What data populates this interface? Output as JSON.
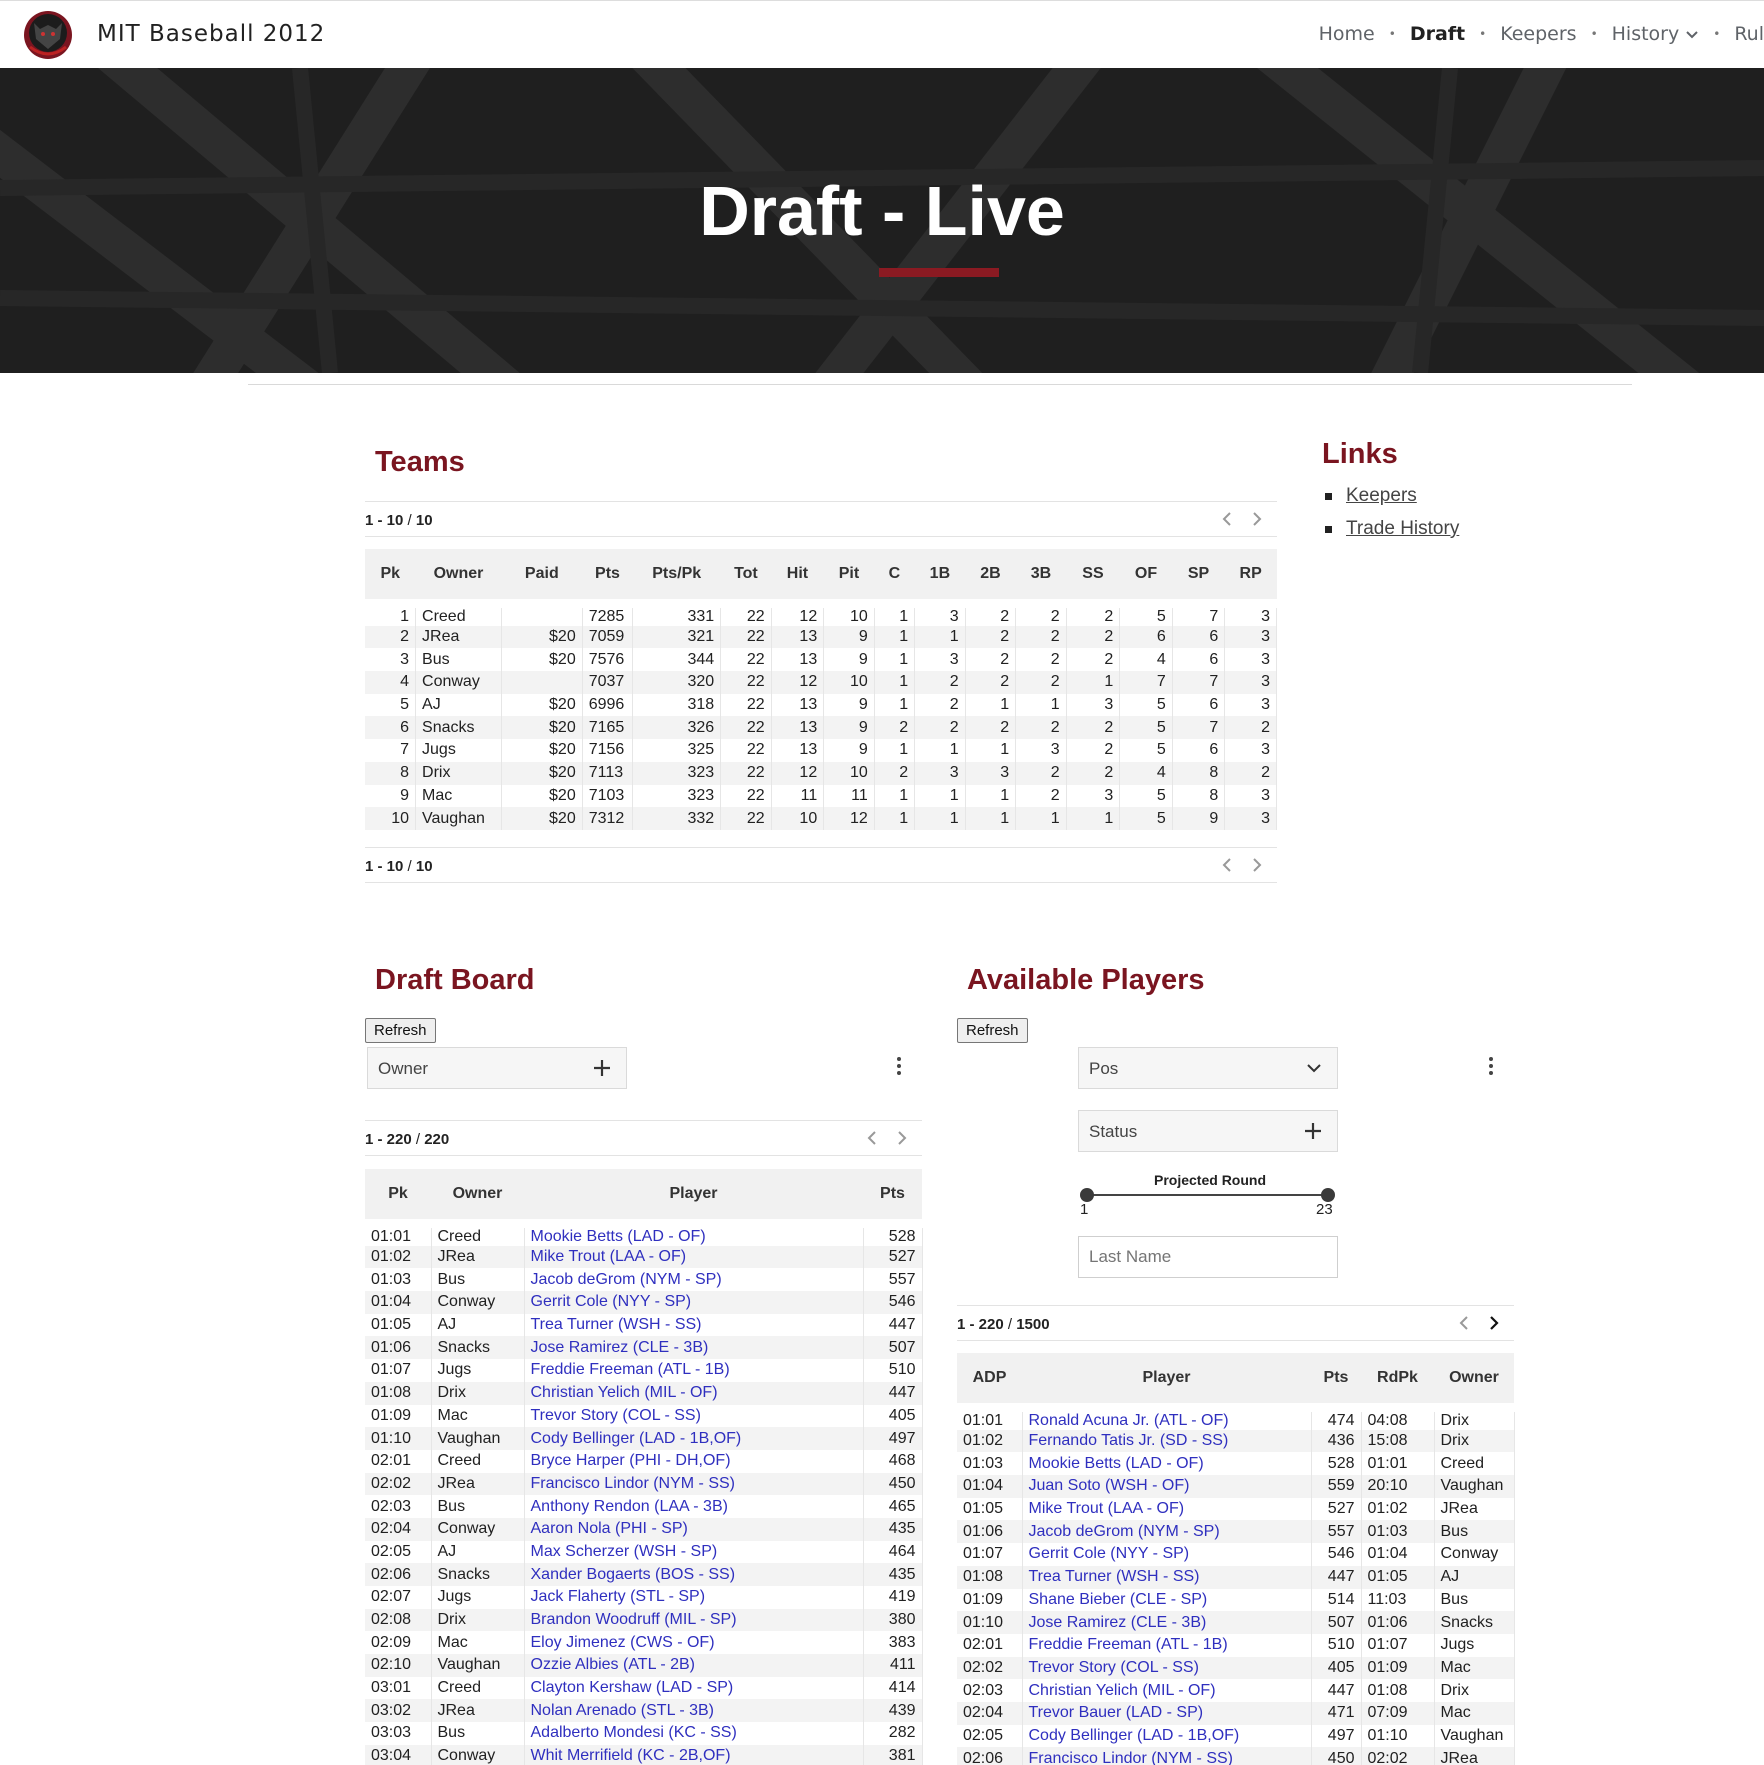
{
  "site": {
    "title": "MIT Baseball 2012"
  },
  "nav": {
    "items": [
      "Home",
      "Draft",
      "Keepers",
      "History",
      "Rul"
    ],
    "active": "Draft"
  },
  "hero": {
    "title": "Draft - Live"
  },
  "teams": {
    "title": "Teams",
    "pager": {
      "range": "1 - 10",
      "total": "10"
    },
    "columns": [
      "Pk",
      "Owner",
      "Paid",
      "Pts",
      "Pts/Pk",
      "Tot",
      "Hit",
      "Pit",
      "C",
      "1B",
      "2B",
      "3B",
      "SS",
      "OF",
      "SP",
      "RP"
    ],
    "rows": [
      [
        "1",
        "Creed",
        "",
        "7285",
        "331",
        "22",
        "12",
        "10",
        "1",
        "3",
        "2",
        "2",
        "2",
        "5",
        "7",
        "3"
      ],
      [
        "2",
        "JRea",
        "$20",
        "7059",
        "321",
        "22",
        "13",
        "9",
        "1",
        "1",
        "2",
        "2",
        "2",
        "6",
        "6",
        "3"
      ],
      [
        "3",
        "Bus",
        "$20",
        "7576",
        "344",
        "22",
        "13",
        "9",
        "1",
        "3",
        "2",
        "2",
        "2",
        "4",
        "6",
        "3"
      ],
      [
        "4",
        "Conway",
        "",
        "7037",
        "320",
        "22",
        "12",
        "10",
        "1",
        "2",
        "2",
        "2",
        "1",
        "7",
        "7",
        "3"
      ],
      [
        "5",
        "AJ",
        "$20",
        "6996",
        "318",
        "22",
        "13",
        "9",
        "1",
        "2",
        "1",
        "1",
        "3",
        "5",
        "6",
        "3"
      ],
      [
        "6",
        "Snacks",
        "$20",
        "7165",
        "326",
        "22",
        "13",
        "9",
        "2",
        "2",
        "2",
        "2",
        "2",
        "5",
        "7",
        "2"
      ],
      [
        "7",
        "Jugs",
        "$20",
        "7156",
        "325",
        "22",
        "13",
        "9",
        "1",
        "1",
        "1",
        "3",
        "2",
        "5",
        "6",
        "3"
      ],
      [
        "8",
        "Drix",
        "$20",
        "7113",
        "323",
        "22",
        "12",
        "10",
        "2",
        "3",
        "3",
        "2",
        "2",
        "4",
        "8",
        "2"
      ],
      [
        "9",
        "Mac",
        "$20",
        "7103",
        "323",
        "22",
        "11",
        "11",
        "1",
        "1",
        "1",
        "2",
        "3",
        "5",
        "8",
        "3"
      ],
      [
        "10",
        "Vaughan",
        "$20",
        "7312",
        "332",
        "22",
        "10",
        "12",
        "1",
        "1",
        "1",
        "1",
        "1",
        "5",
        "9",
        "3"
      ]
    ]
  },
  "links": {
    "title": "Links",
    "items": [
      "Keepers",
      "Trade History"
    ]
  },
  "draft_board": {
    "title": "Draft Board",
    "refresh_label": "Refresh",
    "owner_filter_label": "Owner",
    "pager": {
      "range": "1 - 220",
      "total": "220"
    },
    "columns": [
      "Pk",
      "Owner",
      "Player",
      "Pts"
    ],
    "rows": [
      [
        "01:01",
        "Creed",
        "Mookie Betts (LAD - OF)",
        "528"
      ],
      [
        "01:02",
        "JRea",
        "Mike Trout (LAA - OF)",
        "527"
      ],
      [
        "01:03",
        "Bus",
        "Jacob deGrom (NYM - SP)",
        "557"
      ],
      [
        "01:04",
        "Conway",
        "Gerrit Cole (NYY - SP)",
        "546"
      ],
      [
        "01:05",
        "AJ",
        "Trea Turner (WSH - SS)",
        "447"
      ],
      [
        "01:06",
        "Snacks",
        "Jose Ramirez (CLE - 3B)",
        "507"
      ],
      [
        "01:07",
        "Jugs",
        "Freddie Freeman (ATL - 1B)",
        "510"
      ],
      [
        "01:08",
        "Drix",
        "Christian Yelich (MIL - OF)",
        "447"
      ],
      [
        "01:09",
        "Mac",
        "Trevor Story (COL - SS)",
        "405"
      ],
      [
        "01:10",
        "Vaughan",
        "Cody Bellinger (LAD - 1B,OF)",
        "497"
      ],
      [
        "02:01",
        "Creed",
        "Bryce Harper (PHI - DH,OF)",
        "468"
      ],
      [
        "02:02",
        "JRea",
        "Francisco Lindor (NYM - SS)",
        "450"
      ],
      [
        "02:03",
        "Bus",
        "Anthony Rendon (LAA - 3B)",
        "465"
      ],
      [
        "02:04",
        "Conway",
        "Aaron Nola (PHI - SP)",
        "435"
      ],
      [
        "02:05",
        "AJ",
        "Max Scherzer (WSH - SP)",
        "464"
      ],
      [
        "02:06",
        "Snacks",
        "Xander Bogaerts (BOS - SS)",
        "435"
      ],
      [
        "02:07",
        "Jugs",
        "Jack Flaherty (STL - SP)",
        "419"
      ],
      [
        "02:08",
        "Drix",
        "Brandon Woodruff (MIL - SP)",
        "380"
      ],
      [
        "02:09",
        "Mac",
        "Eloy Jimenez (CWS - OF)",
        "383"
      ],
      [
        "02:10",
        "Vaughan",
        "Ozzie Albies (ATL - 2B)",
        "411"
      ],
      [
        "03:01",
        "Creed",
        "Clayton Kershaw (LAD - SP)",
        "414"
      ],
      [
        "03:02",
        "JRea",
        "Nolan Arenado (STL - 3B)",
        "439"
      ],
      [
        "03:03",
        "Bus",
        "Adalberto Mondesi (KC - SS)",
        "282"
      ],
      [
        "03:04",
        "Conway",
        "Whit Merrifield (KC - 2B,OF)",
        "381"
      ]
    ]
  },
  "available_players": {
    "title": "Available Players",
    "refresh_label": "Refresh",
    "pos_label": "Pos",
    "status_label": "Status",
    "slider": {
      "label": "Projected Round",
      "min": "1",
      "max": "23"
    },
    "last_name_placeholder": "Last Name",
    "pager": {
      "range": "1 - 220",
      "total": "1500"
    },
    "columns": [
      "ADP",
      "Player",
      "Pts",
      "RdPk",
      "Owner"
    ],
    "rows": [
      [
        "01:01",
        "Ronald Acuna Jr. (ATL - OF)",
        "474",
        "04:08",
        "Drix"
      ],
      [
        "01:02",
        "Fernando Tatis Jr. (SD - SS)",
        "436",
        "15:08",
        "Drix"
      ],
      [
        "01:03",
        "Mookie Betts (LAD - OF)",
        "528",
        "01:01",
        "Creed"
      ],
      [
        "01:04",
        "Juan Soto (WSH - OF)",
        "559",
        "20:10",
        "Vaughan"
      ],
      [
        "01:05",
        "Mike Trout (LAA - OF)",
        "527",
        "01:02",
        "JRea"
      ],
      [
        "01:06",
        "Jacob deGrom (NYM - SP)",
        "557",
        "01:03",
        "Bus"
      ],
      [
        "01:07",
        "Gerrit Cole (NYY - SP)",
        "546",
        "01:04",
        "Conway"
      ],
      [
        "01:08",
        "Trea Turner (WSH - SS)",
        "447",
        "01:05",
        "AJ"
      ],
      [
        "01:09",
        "Shane Bieber (CLE - SP)",
        "514",
        "11:03",
        "Bus"
      ],
      [
        "01:10",
        "Jose Ramirez (CLE - 3B)",
        "507",
        "01:06",
        "Snacks"
      ],
      [
        "02:01",
        "Freddie Freeman (ATL - 1B)",
        "510",
        "01:07",
        "Jugs"
      ],
      [
        "02:02",
        "Trevor Story (COL - SS)",
        "405",
        "01:09",
        "Mac"
      ],
      [
        "02:03",
        "Christian Yelich (MIL - OF)",
        "447",
        "01:08",
        "Drix"
      ],
      [
        "02:04",
        "Trevor Bauer (LAD - SP)",
        "471",
        "07:09",
        "Mac"
      ],
      [
        "02:05",
        "Cody Bellinger (LAD - 1B,OF)",
        "497",
        "01:10",
        "Vaughan"
      ],
      [
        "02:06",
        "Francisco Lindor (NYM - SS)",
        "450",
        "02:02",
        "JRea"
      ]
    ]
  },
  "colors": {
    "accent": "#7a1520",
    "link": "#2f2fbf",
    "visited": "#6a3fa8"
  }
}
